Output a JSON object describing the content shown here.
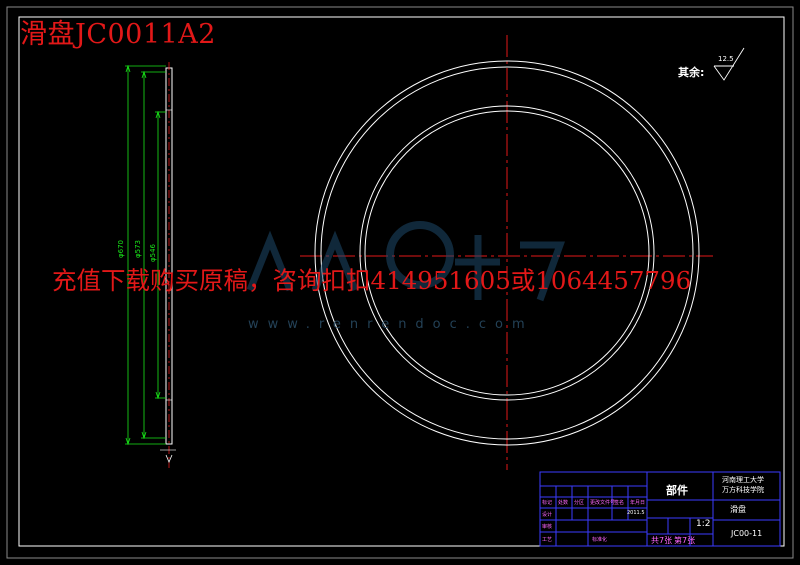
{
  "overlay": {
    "title": "滑盘JC0011A2",
    "ad_text": "充值下载购买原稿，咨询扣扣414951605或1064457796",
    "watermark_url": "www.renrendoc.com"
  },
  "drawing": {
    "roughness_label": "其余:",
    "roughness_value": "12.5",
    "dims": [
      "φ670",
      "φ573",
      "φ546"
    ]
  },
  "title_block": {
    "part_type": "部件",
    "school": "河南理工大学",
    "school_sub": "万方科技学院",
    "part_name": "滑盘",
    "scale": "1:2",
    "sheets": "共7张",
    "sheet_no": "第7张",
    "drawing_no": "JC00-11",
    "year": "2011.5",
    "sign_labels": [
      "设计",
      "审核",
      "工艺",
      "标准化"
    ],
    "header_labels": [
      "标记",
      "处数",
      "分区",
      "更改文件号",
      "签名",
      "年月日"
    ]
  },
  "colors": {
    "background": "#000000",
    "drawing": "#ffffff",
    "center_line": "#e21818",
    "dimension": "#19e619",
    "title_block_line": "#3b3bff",
    "overlay_red": "#e21818",
    "watermark": "#1e3f58"
  }
}
